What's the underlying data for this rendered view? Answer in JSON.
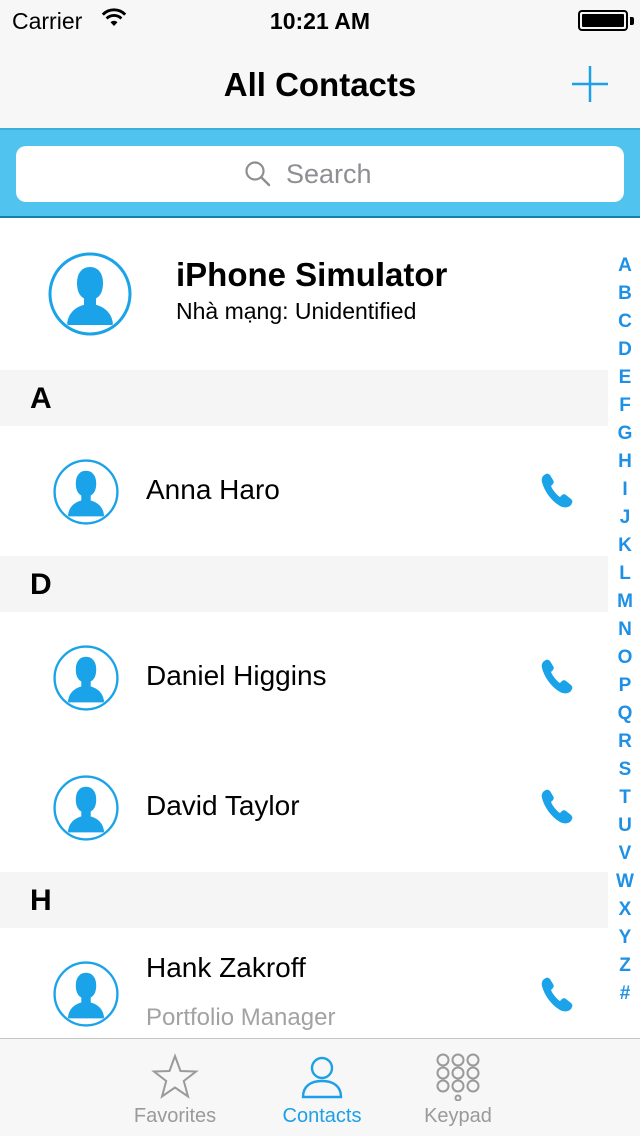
{
  "status_bar": {
    "carrier": "Carrier",
    "time": "10:21 AM"
  },
  "nav": {
    "title": "All Contacts",
    "add_icon": "plus-icon"
  },
  "search": {
    "placeholder": "Search"
  },
  "me_card": {
    "name": "iPhone Simulator",
    "subtitle": "Nhà mạng: Unidentified"
  },
  "sections": [
    {
      "letter": "A",
      "contacts": [
        {
          "name": "Anna Haro",
          "subtitle": ""
        }
      ]
    },
    {
      "letter": "D",
      "contacts": [
        {
          "name": "Daniel Higgins",
          "subtitle": ""
        },
        {
          "name": "David Taylor",
          "subtitle": ""
        }
      ]
    },
    {
      "letter": "H",
      "contacts": [
        {
          "name": "Hank Zakroff",
          "subtitle": "Portfolio Manager"
        }
      ]
    }
  ],
  "index_letters": [
    "A",
    "B",
    "C",
    "D",
    "E",
    "F",
    "G",
    "H",
    "I",
    "J",
    "K",
    "L",
    "M",
    "N",
    "O",
    "P",
    "Q",
    "R",
    "S",
    "T",
    "U",
    "V",
    "W",
    "X",
    "Y",
    "Z",
    "#"
  ],
  "tabs": [
    {
      "label": "Favorites",
      "icon": "star-icon"
    },
    {
      "label": "Contacts",
      "icon": "person-icon"
    },
    {
      "label": "Keypad",
      "icon": "keypad-icon"
    }
  ],
  "colors": {
    "accent": "#1ea0e6",
    "search_bar": "#51c3ef",
    "avatar_blue": "#1aa3e8"
  }
}
